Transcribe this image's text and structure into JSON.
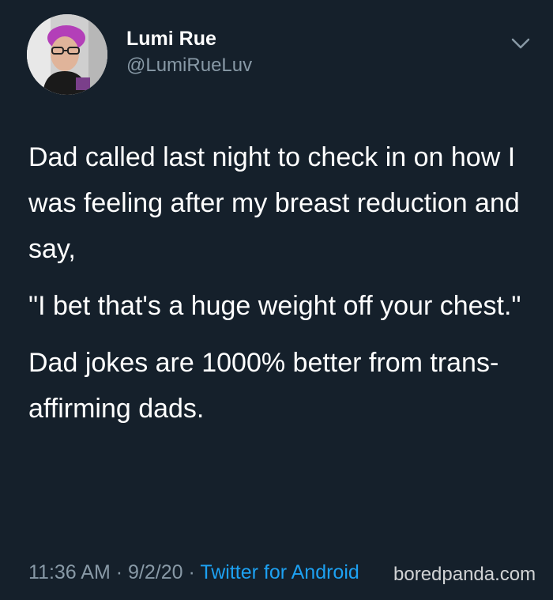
{
  "tweet": {
    "author": {
      "display_name": "Lumi Rue",
      "handle": "@LumiRueLuv"
    },
    "paragraphs": [
      "Dad called last night to check in on how I was feeling after my breast reduction and say,",
      "\"I bet that's a huge weight off your chest.\"",
      "Dad jokes are 1000% better from trans-affirming dads."
    ],
    "time": "11:36 AM",
    "separator": "·",
    "date": "9/2/20",
    "source": "Twitter for Android"
  },
  "watermark": "boredpanda.com",
  "colors": {
    "background": "#15202b",
    "text": "#ffffff",
    "secondary": "#8899a6",
    "link": "#1da1f2"
  }
}
